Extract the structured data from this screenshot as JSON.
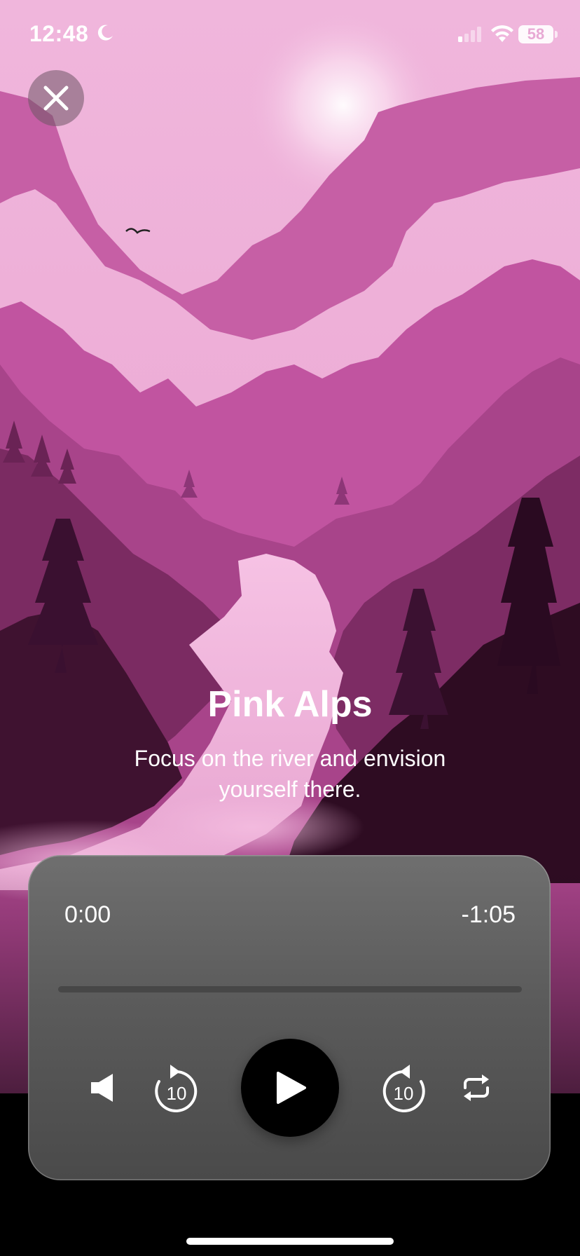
{
  "status_bar": {
    "time": "12:48",
    "battery": "58",
    "icons": [
      "moon-icon",
      "cellular-signal-icon",
      "wifi-icon",
      "battery-icon"
    ]
  },
  "close_button": {
    "icon": "close-icon"
  },
  "meditation": {
    "title": "Pink Alps",
    "description": "Focus on the river and envision yourself there."
  },
  "player": {
    "elapsed": "0:00",
    "remaining": "-1:05",
    "progress": 0,
    "controls": [
      {
        "icon": "volume-icon"
      },
      {
        "icon": "rewind-10-icon",
        "label": "10"
      },
      {
        "icon": "play-icon"
      },
      {
        "icon": "forward-10-icon",
        "label": "10"
      },
      {
        "icon": "repeat-icon"
      }
    ]
  },
  "colors": {
    "sky": "#f1b4dd",
    "mountain_far": "#c760a6",
    "valley_dark": "#2c0d20",
    "player_panel": "#5b5b5b",
    "play_button": "#000000"
  }
}
